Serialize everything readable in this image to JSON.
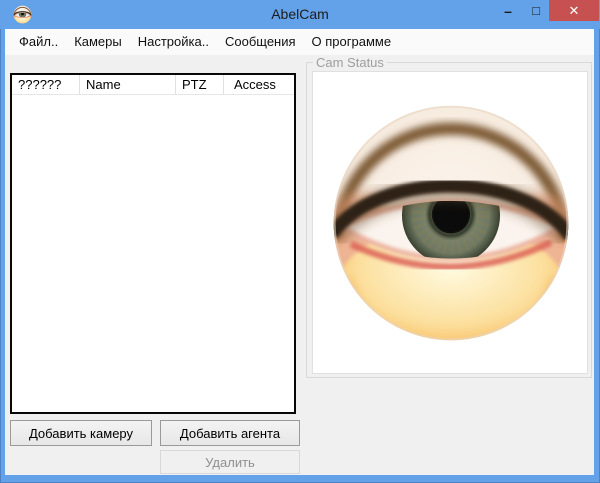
{
  "window": {
    "title": "AbelCam",
    "minimize_glyph": "–",
    "maximize_glyph": "□",
    "close_glyph": "✕"
  },
  "menu": {
    "items": [
      "Файл..",
      "Камеры",
      "Настройка..",
      "Сообщения",
      "О программе"
    ]
  },
  "camera_list": {
    "columns": [
      "??????",
      "Name",
      "PTZ",
      "Access"
    ],
    "rows": []
  },
  "cam_status": {
    "label": "Cam Status"
  },
  "buttons": {
    "add_camera": "Добавить камеру",
    "add_agent": "Добавить агента",
    "delete": "Удалить"
  },
  "colors": {
    "titlebar": "#63a2e8",
    "window-border": "#63a2e8",
    "close-red": "#c75050",
    "form-bg": "#f0f0f0",
    "menubar-bg": "#fafafa",
    "disabled-text": "#8f8f8f",
    "group-label": "#9e9e9e"
  }
}
